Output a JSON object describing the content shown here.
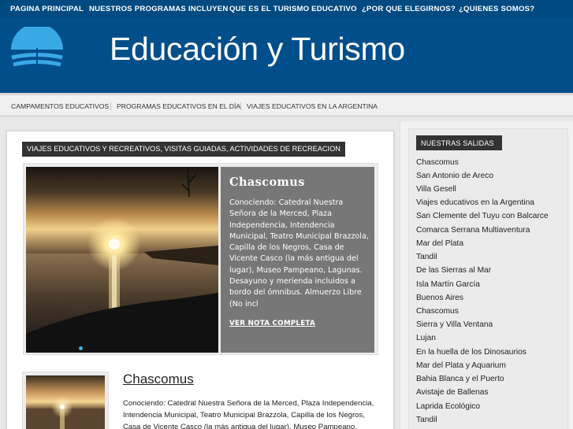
{
  "top_nav": {
    "items": [
      {
        "label": "PAGINA PRINCIPAL"
      },
      {
        "label": "NUESTROS PROGRAMAS INCLUYEN"
      },
      {
        "label": "QUE ES EL TURISMO EDUCATIVO"
      },
      {
        "label": "¿POR QUE ELEGIRNOS?"
      },
      {
        "label": "¿QUIENES SOMOS?"
      }
    ]
  },
  "header": {
    "site_title": "Educación y Turismo",
    "logo_icon": "open-book-icon",
    "colors": {
      "top_nav_bg": "#004a82",
      "header_bg": "#004e8a",
      "logo_blue": "#39a9e6"
    }
  },
  "sub_nav": {
    "items": [
      {
        "label": "CAMPAMENTOS EDUCATIVOS"
      },
      {
        "label": "PROGRAMAS EDUCATIVOS EN EL DÍA"
      },
      {
        "label": "VIAJES EDUCATIVOS EN LA ARGENTINA"
      }
    ]
  },
  "main": {
    "section_label": "VIAJES EDUCATIVOS Y RECREATIVOS, VISITAS GUIADAS, ACTIVIDADES DE RECREACION",
    "featured": {
      "title": "Chascomus",
      "excerpt": "Conociendo: Catedral Nuestra Señora de la Merced, Plaza Independencia, Intendencia Municipal, Teatro Municipal Brazzola, Capilla de los Negros, Casa de Vicente Casco (la más antigua del lugar), Museo Pampeano, Lagunas. Desayuno y merienda incluidos a bordo del ómnibus. Almuerzo Libre (No incl",
      "read_more": "VER NOTA COMPLETA"
    },
    "post": {
      "title": "Chascomus",
      "excerpt": "Conociendo: Catedral Nuestra Señora de la Merced, Plaza Independencia, Intendencia Municipal, Teatro Municipal Brazzola, Capilla de los Negros, Casa de Vicente Casco (la más antigua del lugar), Museo Pampeano, Lagunas."
    }
  },
  "sidebar": {
    "widget_title": "NUESTRAS SALIDAS",
    "items": [
      {
        "label": "Chascomus"
      },
      {
        "label": "San Antonio de Areco"
      },
      {
        "label": "Villa Gesell"
      },
      {
        "label": "Viajes educativos en la Argentina"
      },
      {
        "label": "San Clemente del Tuyu con Balcarce"
      },
      {
        "label": "Comarca Serrana Multiaventura"
      },
      {
        "label": "Mar del Plata"
      },
      {
        "label": "Tandil"
      },
      {
        "label": "De las Sierras al Mar"
      },
      {
        "label": "Isla Martín García"
      },
      {
        "label": "Buenos Aires"
      },
      {
        "label": "Chascomus"
      },
      {
        "label": "Sierra y Villa Ventana"
      },
      {
        "label": "Lujan"
      },
      {
        "label": "En la huella de los Dinosaurios"
      },
      {
        "label": "Mar del Plata y Aquarium"
      },
      {
        "label": "Bahia Blanca y el Puerto"
      },
      {
        "label": "Avistaje de Ballenas"
      },
      {
        "label": "Laprida Ecológico"
      },
      {
        "label": "Tandil"
      }
    ]
  }
}
